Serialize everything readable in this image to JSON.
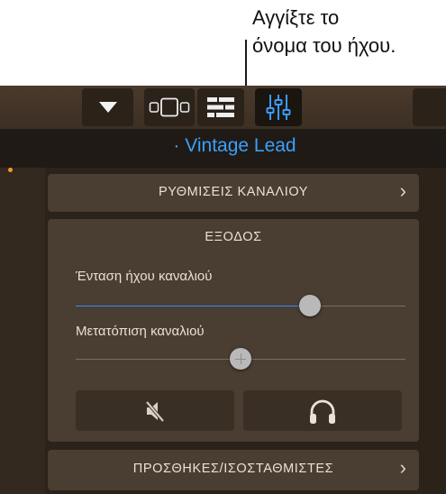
{
  "callout": {
    "line1": "Αγγίξτε το",
    "line2": "όνομα του ήχου."
  },
  "toolbar": {
    "buttons": [
      {
        "name": "dropdown-arrow-icon"
      },
      {
        "name": "view-switch-icon"
      },
      {
        "name": "tracks-view-icon"
      },
      {
        "name": "mixer-icon",
        "active": true
      }
    ]
  },
  "sound": {
    "dot": "·",
    "name": "Vintage Lead"
  },
  "channel_settings": {
    "label": "ΡΥΘΜΙΣΕΙΣ ΚΑΝΑΛΙΟΥ",
    "chevron": "›"
  },
  "output": {
    "label": "ΕΞΟΔΟΣ",
    "volume": {
      "label": "Ένταση ήχου καναλιού",
      "value": 0.71
    },
    "pan": {
      "label": "Μετατόπιση καναλιού",
      "value": 0.5
    },
    "mute_icon": "speaker-mute-icon",
    "monitor_icon": "headphones-icon"
  },
  "plugins": {
    "label": "ΠΡΟΣΘΗΚΕΣ/ΙΣΟΣΤΑΘΜΙΣΤΕΣ",
    "chevron": "›"
  },
  "colors": {
    "accent": "#3aa0ff",
    "record_dot": "#f09a28",
    "background": "#2a2118"
  }
}
